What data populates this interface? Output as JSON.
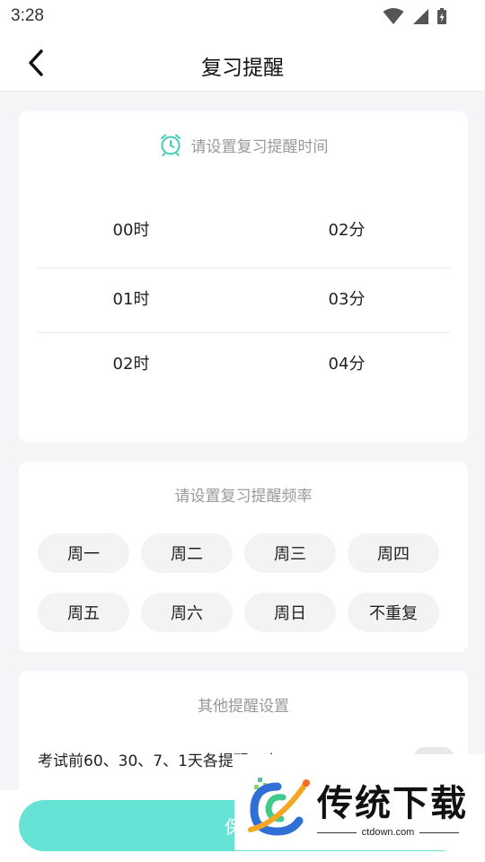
{
  "status_bar": {
    "time": "3:28",
    "icons": [
      "wifi-icon",
      "signal-icon",
      "battery-charging-icon"
    ]
  },
  "app_bar": {
    "title": "复习提醒",
    "back_icon": "chevron-left-icon"
  },
  "time_card": {
    "header": "请设置复习提醒时间",
    "header_icon": "alarm-clock-icon",
    "accent": "#3dcfb4",
    "hours": [
      "00时",
      "01时",
      "02时"
    ],
    "minutes": [
      "02分",
      "03分",
      "04分"
    ]
  },
  "frequency_card": {
    "header": "请设置复习提醒频率",
    "options": [
      "周一",
      "周二",
      "周三",
      "周四",
      "周五",
      "周六",
      "周日",
      "不重复"
    ]
  },
  "other_card": {
    "header": "其他提醒设置",
    "exam_reminder_label": "考试前60、30、7、1天各提醒一次",
    "exam_reminder_enabled": false
  },
  "save_button": {
    "label": "保存",
    "color": "#66e3d5"
  },
  "watermark": {
    "title": "传统下载",
    "site": "ctdown.com"
  }
}
